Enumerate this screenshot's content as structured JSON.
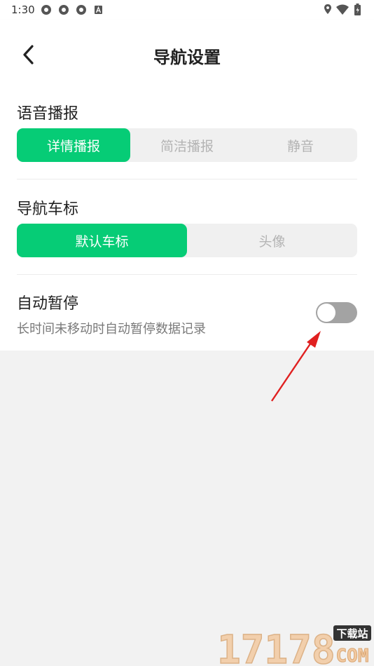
{
  "status_bar": {
    "time": "1:30",
    "left_icons": [
      "notification-icon",
      "notification-icon",
      "notification-icon",
      "a-icon"
    ],
    "right_icons": [
      "location-icon",
      "wifi-icon",
      "battery-icon"
    ]
  },
  "header": {
    "title": "导航设置",
    "back_icon": "chevron-left-icon"
  },
  "voice": {
    "title": "语音播报",
    "options": [
      "详情播报",
      "简洁播报",
      "静音"
    ],
    "selected": "详情播报"
  },
  "car_marker": {
    "title": "导航车标",
    "options": [
      "默认车标",
      "头像"
    ],
    "selected": "默认车标"
  },
  "auto_pause": {
    "title": "自动暂停",
    "description": "长时间未移动时自动暂停数据记录",
    "enabled": false
  },
  "watermark": {
    "number": "17178",
    "tag": "下载站",
    "domain": "COM"
  },
  "colors": {
    "accent": "#06cc76",
    "toggle_off": "#a3a3a3",
    "arrow": "#e02020"
  }
}
